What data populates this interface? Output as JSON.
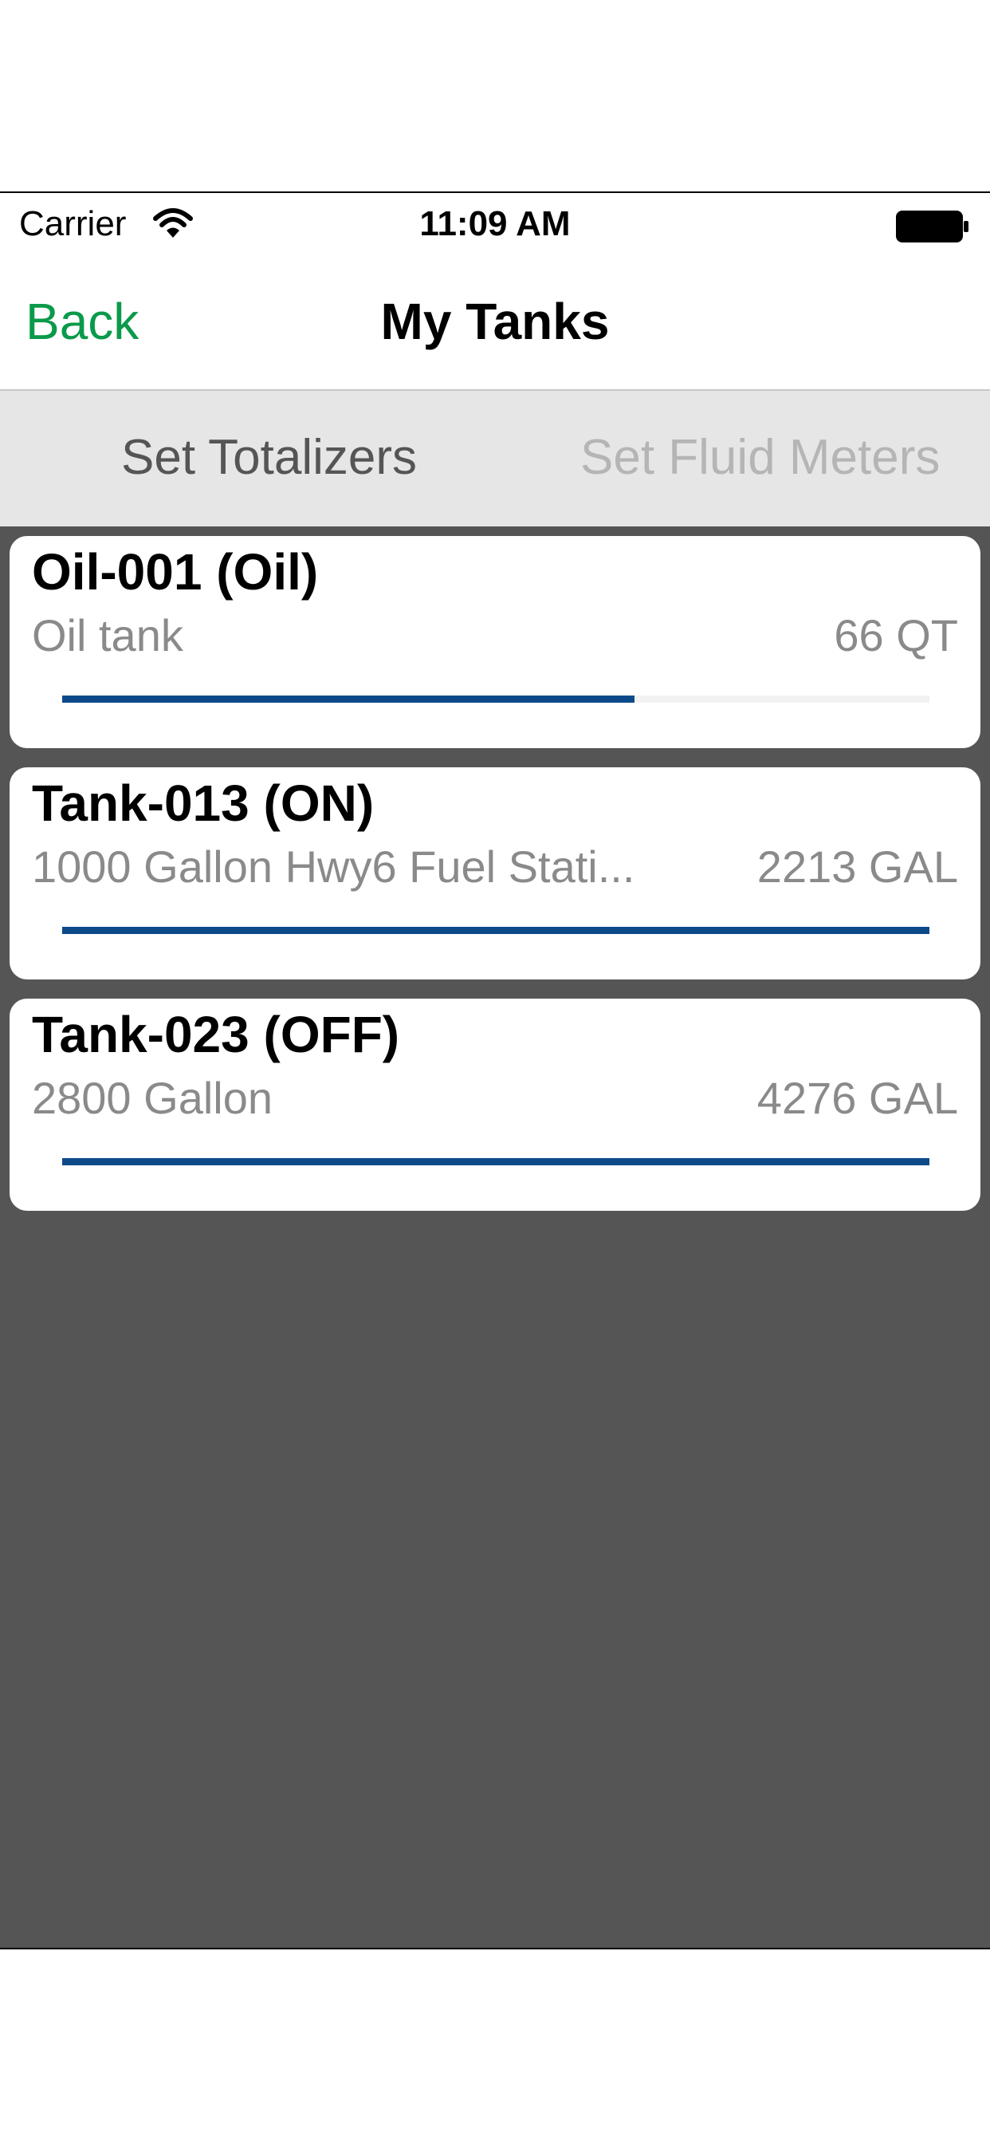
{
  "status_bar": {
    "carrier": "Carrier",
    "time": "11:09 AM",
    "wifi_icon": "wifi-icon",
    "battery_icon": "battery-icon"
  },
  "nav": {
    "back_label": "Back",
    "title": "My Tanks",
    "back_color": "#0a9a4a"
  },
  "tabs": [
    {
      "label": "Set Totalizers",
      "active": true
    },
    {
      "label": "Set Fluid Meters",
      "active": false
    }
  ],
  "tanks": [
    {
      "name": "Oil-001 (Oil)",
      "description": "Oil tank",
      "quantity": "66 QT",
      "level_fraction": 0.66
    },
    {
      "name": "Tank-013 (ON)",
      "description": "1000 Gallon Hwy6 Fuel Stati...",
      "quantity": "2213 GAL",
      "level_fraction": 1.0
    },
    {
      "name": "Tank-023 (OFF)",
      "description": "2800 Gallon",
      "quantity": "4276 GAL",
      "level_fraction": 1.0
    }
  ],
  "colors": {
    "level_bar": "#0c4a8a",
    "content_background": "#555555",
    "segment_background": "#e6e6e6"
  }
}
